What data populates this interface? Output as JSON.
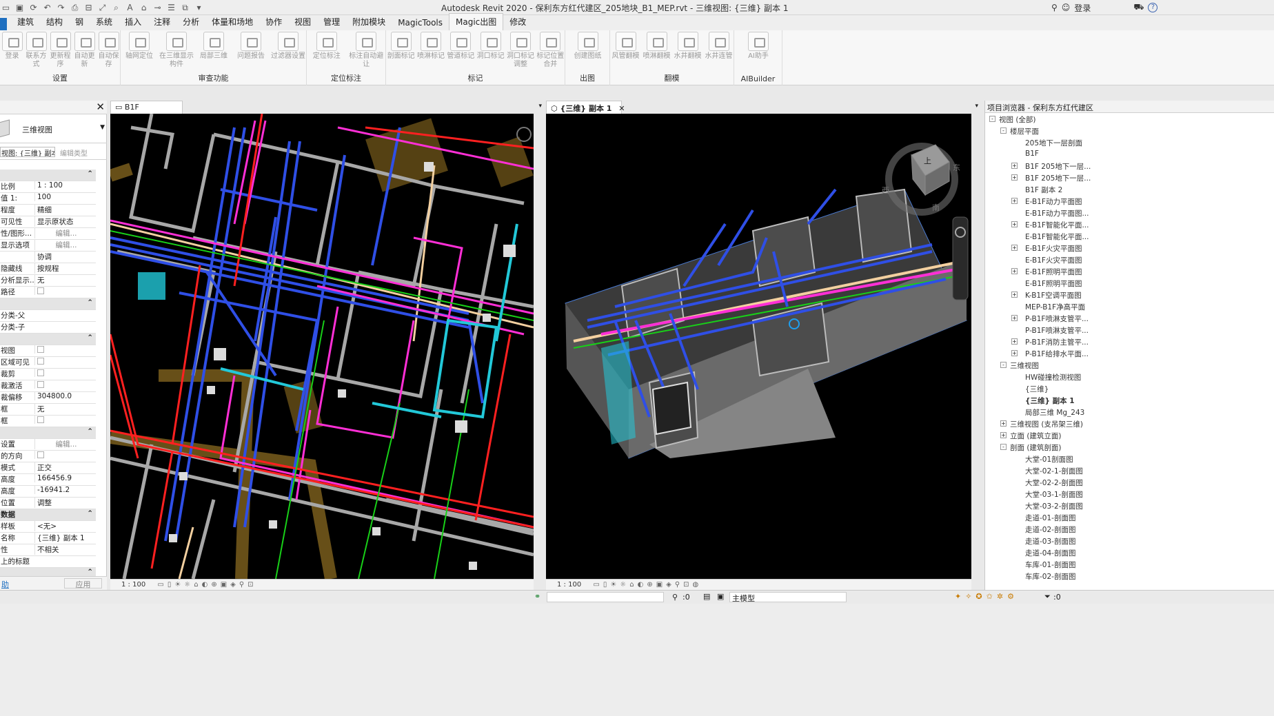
{
  "titlebar": {
    "app_title": "Autodesk Revit 2020 - 保利东方红代建区_205地块_B1_MEP.rvt - 三维视图: {三维} 副本 1",
    "sign_in": "登录",
    "help": "?"
  },
  "menu": {
    "tabs": [
      "建筑",
      "结构",
      "钢",
      "系统",
      "插入",
      "注释",
      "分析",
      "体量和场地",
      "协作",
      "视图",
      "管理",
      "附加模块",
      "MagicTools",
      "Magic出图",
      "修改"
    ],
    "active": "Magic出图"
  },
  "ribbon": {
    "groups": [
      {
        "title": "设置",
        "buttons": [
          "登录",
          "联系方式",
          "更新程序",
          "自动更新",
          "自动保存"
        ]
      },
      {
        "title": "审查功能",
        "buttons": [
          "轴网定位",
          "在三维显示构件",
          "局部三维",
          "问题报告",
          "过滤器设置"
        ]
      },
      {
        "title": "定位标注",
        "buttons": [
          "定位标注",
          "标注自动避让"
        ]
      },
      {
        "title": "标记",
        "buttons": [
          "剖面标记",
          "喷淋标记",
          "管道标记",
          "洞口标记",
          "洞口标记调整",
          "标记位置合并"
        ]
      },
      {
        "title": "出图",
        "buttons": [
          "创建图纸"
        ]
      },
      {
        "title": "翻模",
        "buttons": [
          "风管翻模",
          "喷淋翻模",
          "水井翻模",
          "水井连管"
        ]
      },
      {
        "title": "AIBuilder",
        "buttons": [
          "AI助手"
        ]
      }
    ]
  },
  "properties": {
    "type_name": "三维视图",
    "selector": "视图: {三维} 副本",
    "edit_type": "编辑类型",
    "rows": [
      {
        "k": "",
        "v": "",
        "sec": true
      },
      {
        "k": "比例",
        "v": "1 : 100"
      },
      {
        "k": "值 1:",
        "v": "100"
      },
      {
        "k": "程度",
        "v": "精细"
      },
      {
        "k": "可见性",
        "v": "显示原状态"
      },
      {
        "k": "性/图形...",
        "v": "编辑...",
        "btn": true
      },
      {
        "k": "显示选项",
        "v": "编辑...",
        "btn": true
      },
      {
        "k": "",
        "v": "协调"
      },
      {
        "k": "隐藏线",
        "v": "按规程"
      },
      {
        "k": "分析显示...",
        "v": "无"
      },
      {
        "k": "路径",
        "v": "",
        "chk": true
      },
      {
        "k": "",
        "v": "",
        "sec": true
      },
      {
        "k": "分类-父",
        "v": ""
      },
      {
        "k": "分类-子",
        "v": ""
      },
      {
        "k": "",
        "v": "",
        "sec": true
      },
      {
        "k": "视图",
        "v": "",
        "chk": true
      },
      {
        "k": "区域可见",
        "v": "",
        "chk": true
      },
      {
        "k": "裁剪",
        "v": "",
        "chk": true
      },
      {
        "k": "裁激活",
        "v": "",
        "chk": true
      },
      {
        "k": "裁偏移",
        "v": "304800.0"
      },
      {
        "k": "框",
        "v": "无"
      },
      {
        "k": "框",
        "v": "",
        "chk": true
      },
      {
        "k": "",
        "v": "",
        "sec": true
      },
      {
        "k": "设置",
        "v": "编辑...",
        "btn": true
      },
      {
        "k": "的方向",
        "v": "",
        "chk": true
      },
      {
        "k": "模式",
        "v": "正交"
      },
      {
        "k": "高度",
        "v": "166456.9"
      },
      {
        "k": "高度",
        "v": "-16941.2"
      },
      {
        "k": "位置",
        "v": "调整"
      },
      {
        "k": "数据",
        "v": "",
        "sec": true
      },
      {
        "k": "样板",
        "v": "<无>"
      },
      {
        "k": "名称",
        "v": "{三维} 副本 1"
      },
      {
        "k": "性",
        "v": "不相关"
      },
      {
        "k": "上的标题",
        "v": ""
      },
      {
        "k": "",
        "v": "",
        "sec": true
      }
    ],
    "help_link": "助",
    "apply": "应用"
  },
  "view_left": {
    "tab": "B1F",
    "scale": "1 : 100"
  },
  "view_right": {
    "tab": "{三维} 副本 1",
    "scale": "1 : 100",
    "cube": {
      "top": "上",
      "east": "东",
      "west": "西",
      "south": "南"
    }
  },
  "browser": {
    "title": "项目浏览器 - 保利东方红代建区",
    "nodes": [
      {
        "t": "视图 (全部)",
        "lvl": 0,
        "g": "-"
      },
      {
        "t": "楼层平面",
        "lvl": 1,
        "g": "-"
      },
      {
        "t": "205地下一层剖面",
        "lvl": 2,
        "g": ""
      },
      {
        "t": "B1F",
        "lvl": 2,
        "g": ""
      },
      {
        "t": "B1F 205地下一层...",
        "lvl": 2,
        "g": "+"
      },
      {
        "t": "B1F 205地下一层...",
        "lvl": 2,
        "g": "+"
      },
      {
        "t": "B1F 副本 2",
        "lvl": 2,
        "g": ""
      },
      {
        "t": "E-B1F动力平面图",
        "lvl": 2,
        "g": "+"
      },
      {
        "t": "E-B1F动力平面图...",
        "lvl": 2,
        "g": ""
      },
      {
        "t": "E-B1F智能化平面...",
        "lvl": 2,
        "g": "+"
      },
      {
        "t": "E-B1F智能化平面...",
        "lvl": 2,
        "g": ""
      },
      {
        "t": "E-B1F火灾平面图",
        "lvl": 2,
        "g": "+"
      },
      {
        "t": "E-B1F火灾平面图",
        "lvl": 2,
        "g": ""
      },
      {
        "t": "E-B1F照明平面图",
        "lvl": 2,
        "g": "+"
      },
      {
        "t": "E-B1F照明平面图",
        "lvl": 2,
        "g": ""
      },
      {
        "t": "K-B1F空调平面图",
        "lvl": 2,
        "g": "+"
      },
      {
        "t": "MEP-B1F净高平面",
        "lvl": 2,
        "g": ""
      },
      {
        "t": "P-B1F喷淋支管平...",
        "lvl": 2,
        "g": "+"
      },
      {
        "t": "P-B1F喷淋支管平...",
        "lvl": 2,
        "g": ""
      },
      {
        "t": "P-B1F消防主管平...",
        "lvl": 2,
        "g": "+"
      },
      {
        "t": "P-B1F给排水平面...",
        "lvl": 2,
        "g": "+"
      },
      {
        "t": "三维视图",
        "lvl": 1,
        "g": "-"
      },
      {
        "t": "HW碰撞检测视图",
        "lvl": 2,
        "g": ""
      },
      {
        "t": "{三维}",
        "lvl": 2,
        "g": ""
      },
      {
        "t": "{三维} 副本 1",
        "lvl": 2,
        "g": "",
        "bold": true
      },
      {
        "t": "局部三维 Mg_243",
        "lvl": 2,
        "g": ""
      },
      {
        "t": "三维视图 (支吊架三维)",
        "lvl": 1,
        "g": "+"
      },
      {
        "t": "立面 (建筑立面)",
        "lvl": 1,
        "g": "+"
      },
      {
        "t": "剖面 (建筑剖面)",
        "lvl": 1,
        "g": "-"
      },
      {
        "t": "大堂-01剖面图",
        "lvl": 2,
        "g": ""
      },
      {
        "t": "大堂-02-1-剖面图",
        "lvl": 2,
        "g": ""
      },
      {
        "t": "大堂-02-2-剖面图",
        "lvl": 2,
        "g": ""
      },
      {
        "t": "大堂-03-1-剖面图",
        "lvl": 2,
        "g": ""
      },
      {
        "t": "大堂-03-2-剖面图",
        "lvl": 2,
        "g": ""
      },
      {
        "t": "走道-01-剖面图",
        "lvl": 2,
        "g": ""
      },
      {
        "t": "走道-02-剖面图",
        "lvl": 2,
        "g": ""
      },
      {
        "t": "走道-03-剖面图",
        "lvl": 2,
        "g": ""
      },
      {
        "t": "走道-04-剖面图",
        "lvl": 2,
        "g": ""
      },
      {
        "t": "车库-01-剖面图",
        "lvl": 2,
        "g": ""
      },
      {
        "t": "车库-02-剖面图",
        "lvl": 2,
        "g": ""
      }
    ]
  },
  "statusbar": {
    "zero": ":0",
    "model": "主模型",
    "filter": ":0"
  },
  "colors": {
    "accent": "#1e6fc0",
    "pipe_blue": "#2f4fe6",
    "pipe_magenta": "#ff2fd6",
    "pipe_red": "#ff2020",
    "pipe_green": "#18d018",
    "pipe_cyan": "#22c8d8"
  }
}
